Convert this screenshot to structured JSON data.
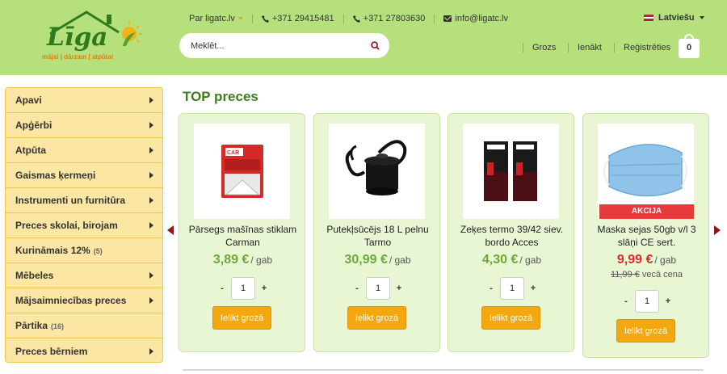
{
  "logo": {
    "name": "Līga",
    "tagline": "mājai | dārzam | atpūtai"
  },
  "topbar": {
    "about": "Par ligatc.lv",
    "phone1": "+371 29415481",
    "phone2": "+371 27803630",
    "email": "info@ligatc.lv",
    "language": "Latviešu"
  },
  "search": {
    "placeholder": "Meklēt..."
  },
  "nav": {
    "cart": "Grozs",
    "login": "Ienākt",
    "register": "Reģistrēties",
    "cart_count": "0"
  },
  "colors": {
    "header_bg": "#b6e07c",
    "accent_green": "#3f7c1e",
    "button_orange": "#f3a80f",
    "sale_red": "#e53b3b"
  },
  "sidebar": {
    "items": [
      {
        "label": "Apavi",
        "count": "",
        "has_arrow": true
      },
      {
        "label": "Apģērbi",
        "count": "",
        "has_arrow": true
      },
      {
        "label": "Atpūta",
        "count": "",
        "has_arrow": true
      },
      {
        "label": "Gaismas ķermeņi",
        "count": "",
        "has_arrow": true
      },
      {
        "label": "Instrumenti un furnitūra",
        "count": "",
        "has_arrow": true
      },
      {
        "label": "Preces skolai, birojam",
        "count": "",
        "has_arrow": true
      },
      {
        "label": "Kurināmais 12%",
        "count": "(5)",
        "has_arrow": false
      },
      {
        "label": "Mēbeles",
        "count": "",
        "has_arrow": true
      },
      {
        "label": "Mājsaimniecības preces",
        "count": "",
        "has_arrow": true
      },
      {
        "label": "Pārtika",
        "count": "(16)",
        "has_arrow": false
      },
      {
        "label": "Preces bērniem",
        "count": "",
        "has_arrow": true
      }
    ]
  },
  "main": {
    "title": "TOP preces",
    "products": [
      {
        "name": "Pārsegs mašīnas stiklam Carman",
        "price": "3,89 €",
        "unit": "/ gab",
        "qty": "1",
        "button": "Ielikt grozā",
        "image_icon": "windshield-cover-icon"
      },
      {
        "name": "Putekļsūcējs 18 L pelnu Tarmo",
        "price": "30,99 €",
        "unit": "/ gab",
        "qty": "1",
        "button": "Ielikt grozā",
        "image_icon": "ash-vacuum-icon"
      },
      {
        "name": "Zeķes termo 39/42 siev. bordo Acces",
        "price": "4,30 €",
        "unit": "/ gab",
        "qty": "1",
        "button": "Ielikt grozā",
        "image_icon": "socks-icon"
      },
      {
        "name": "Maska sejas 50gb v/l 3 slāņi CE sert.",
        "price": "9,99 €",
        "unit": "/ gab",
        "old_price": "11,99 €",
        "old_label": "vecā cena",
        "badge": "AKCIJA",
        "qty": "1",
        "button": "Ielikt grozā",
        "image_icon": "face-mask-icon"
      }
    ]
  }
}
